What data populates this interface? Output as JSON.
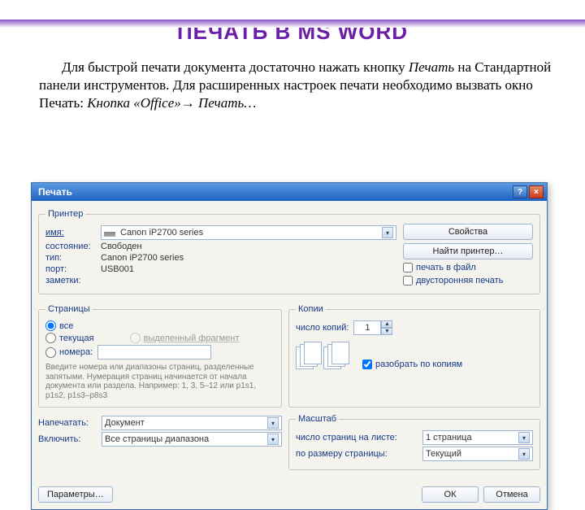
{
  "slide": {
    "title": "ПЕЧАТЬ В MS WORD",
    "para_a": "Для быстрой печати документа достаточно нажать кнопку ",
    "para_b_italic": "Печать",
    "para_c": " на Стандартной панели инструментов. Для расширенных настроек печати необходимо вызвать окно Печать: ",
    "para_d_italic": "Кнопка «Office»→ Печать…"
  },
  "dlg": {
    "title": "Печать",
    "help_glyph": "?",
    "close_glyph": "×",
    "printer": {
      "legend": "Принтер",
      "name_label": "имя:",
      "name_value": "Canon iP2700 series",
      "state_label": "состояние:",
      "state_value": "Свободен",
      "type_label": "тип:",
      "type_value": "Canon iP2700 series",
      "port_label": "порт:",
      "port_value": "USB001",
      "notes_label": "заметки:",
      "btn_props": "Свойства",
      "btn_find": "Найти принтер…",
      "chk_tofile": "печать в файл",
      "chk_duplex": "двусторонняя печать"
    },
    "pages": {
      "legend": "Страницы",
      "r_all": "все",
      "r_current": "текущая",
      "r_selection": "выделенный фрагмент",
      "r_numbers": "номера:",
      "numbers_value": "",
      "hint": "Введите номера или диапазоны страниц, разделенные запятыми. Нумерация страниц начинается от начала документа или раздела. Например: 1, 3, 5–12 или p1s1, p1s2, p1s3–p8s3"
    },
    "copies": {
      "legend": "Копии",
      "count_label": "число копий:",
      "count_value": "1",
      "collate": "разобрать по копиям"
    },
    "print_what": {
      "napech_label": "Напечатать:",
      "napech_value": "Документ",
      "include_label": "Включить:",
      "include_value": "Все страницы диапазона"
    },
    "scale": {
      "legend": "Масштаб",
      "per_sheet_label": "число страниц на листе:",
      "per_sheet_value": "1 страница",
      "size_label": "по размеру страницы:",
      "size_value": "Текущий"
    },
    "footer": {
      "params": "Параметры…",
      "ok": "ОК",
      "cancel": "Отмена"
    }
  }
}
